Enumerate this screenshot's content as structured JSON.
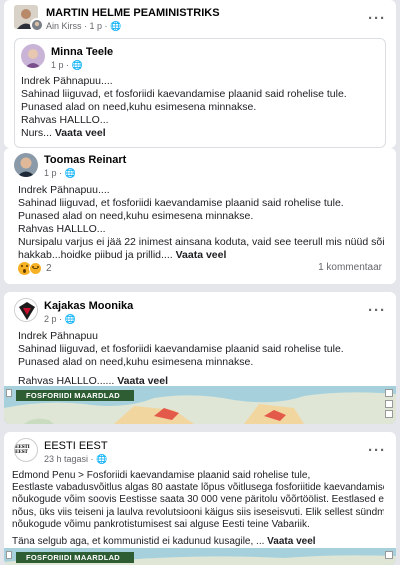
{
  "post1": {
    "author": "MARTIN HELME PEAMINISTRIKS",
    "sharer": "Ain Kirss",
    "time": "1 p",
    "embedded": {
      "author": "Minna Teele",
      "time": "1 p",
      "lines": [
        "Indrek Pähnapuu....",
        "Sahinad liiguvad, et fosforiidi kaevandamise plaanid  said rohelise tule.",
        "Punased alad on need,kuhu esimesena minnakse.",
        "Rahvas HALLLO...",
        "Nurs..."
      ],
      "see_more": "Vaata veel"
    }
  },
  "post2": {
    "author": "Toomas Reinart",
    "time": "1 p",
    "lines": [
      "Indrek Pähnapuu....",
      "Sahinad liiguvad, et fosforiidi kaevandamise plaanid  said rohelise tule.",
      "Punased alad on need,kuhu esimesena minnakse.",
      "Rahvas HALLLO...",
      "Nursipalu varjus ei jää 22 inimest ainsana koduta, vaid see teerull mis nüüd sõitma",
      "hakkab...hoidke piibud ja prillid...."
    ],
    "see_more": "Vaata veel",
    "reaction_count": "2",
    "comments": "1 kommentaar"
  },
  "post3": {
    "author": "Kajakas Moonika",
    "time": "2 p",
    "lines": [
      "Indrek Pähnapuu",
      "Sahinad liiguvad, et fosforiidi kaevandamise plaanid  said rohelise tule.",
      "Punased alad on need,kuhu esimesena minnakse."
    ],
    "last_line": "Rahvas HALLLO......",
    "see_more": "Vaata veel",
    "map_label": "FOSFORIIDI MAARDLAD"
  },
  "post4": {
    "author": "EESTI EEST",
    "logo_text": "EESTI EEST",
    "time": "23 h tagasi",
    "lines": [
      "Edmond Penu > Fosforiidi kaevandamise plaanid said rohelise tule,",
      "Eestlaste vabadusvõitlus algas 80 aastate lõpus võitlusega fosforiitide kaevandamise vastu, kus",
      "nõukogude võim soovis Eestisse saata 30 000 vene päritolu võõrtöölist. Eestlased ei olnud sellega",
      "nõus, üks viis teiseni ja laulva revolutsiooni käigus siis iseseisvuti. Elik sellest sündmusest ja",
      "nõukogude võimu pankrotistumisest sai alguse Eesti teine Vabariik."
    ],
    "last_line": "Täna selgub aga, et kommunistid ei kadunud kusagile, ...",
    "see_more": "Vaata veel",
    "map_label": "FOSFORIIDI MAARDLAD"
  }
}
